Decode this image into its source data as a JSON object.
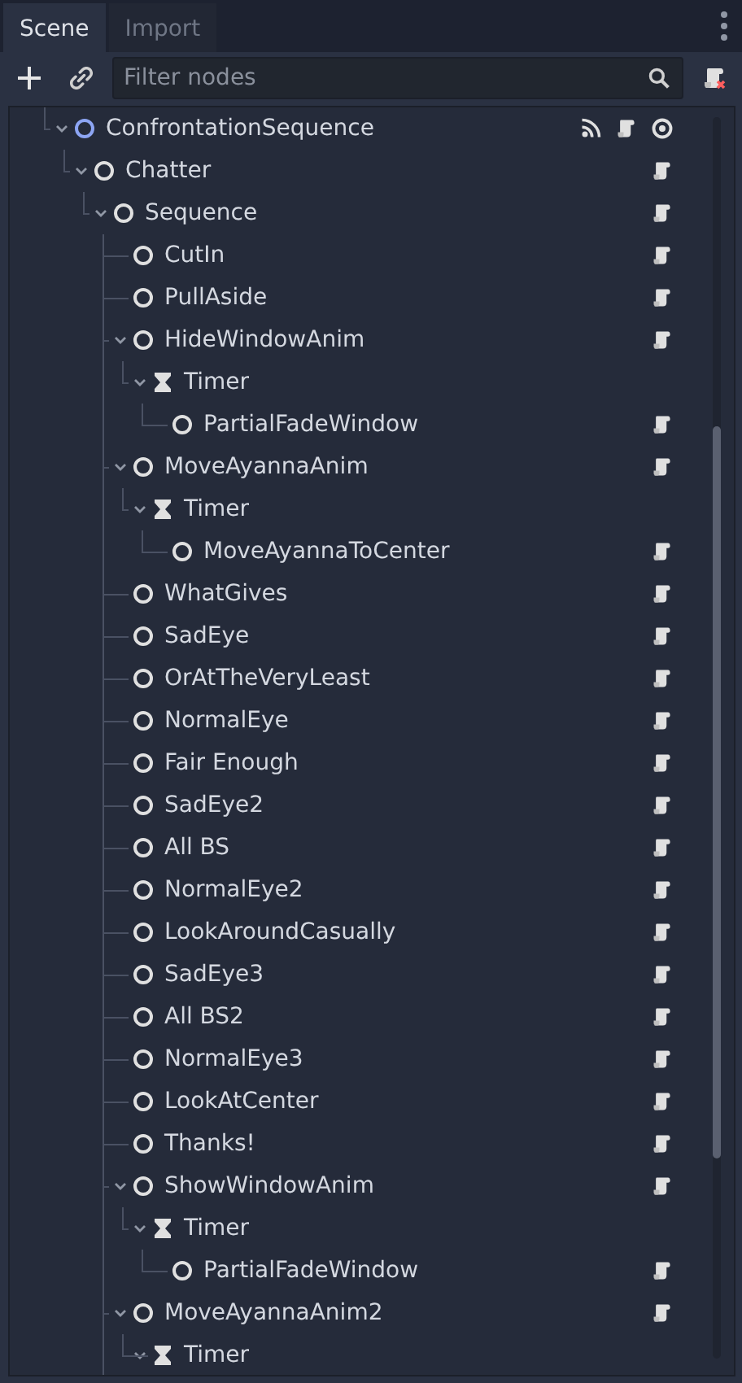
{
  "tabs": [
    {
      "label": "Scene",
      "selected": true
    },
    {
      "label": "Import",
      "selected": false
    }
  ],
  "toolbar": {
    "filter": {
      "placeholder": "Filter nodes"
    }
  },
  "tree": [
    {
      "name": "ConfrontationSequence",
      "kind": "node",
      "color": "#8da5f3",
      "expanded": true,
      "badges": [
        {
          "kind": "signal"
        },
        {
          "kind": "script"
        },
        {
          "kind": "visibility"
        }
      ],
      "children": [
        {
          "name": "Chatter",
          "kind": "node",
          "color": "#e0e0e0",
          "expanded": true,
          "badges": [
            {
              "kind": "script"
            }
          ],
          "children": [
            {
              "name": "Sequence",
              "kind": "node",
              "color": "#e0e0e0",
              "expanded": true,
              "continues_below": true,
              "badges": [
                {
                  "kind": "script"
                }
              ],
              "children": [
                {
                  "name": "CutIn",
                  "kind": "node",
                  "color": "#e0e0e0",
                  "badges": [
                    {
                      "kind": "script"
                    }
                  ]
                },
                {
                  "name": "PullAside",
                  "kind": "node",
                  "color": "#e0e0e0",
                  "badges": [
                    {
                      "kind": "script"
                    }
                  ]
                },
                {
                  "name": "HideWindowAnim",
                  "kind": "node",
                  "color": "#e0e0e0",
                  "expanded": true,
                  "badges": [
                    {
                      "kind": "script"
                    }
                  ],
                  "children": [
                    {
                      "name": "Timer",
                      "kind": "timer",
                      "color": "#e0e0e0",
                      "expanded": true,
                      "children": [
                        {
                          "name": "PartialFadeWindow",
                          "kind": "node",
                          "color": "#e0e0e0",
                          "badges": [
                            {
                              "kind": "script"
                            }
                          ]
                        }
                      ]
                    }
                  ]
                },
                {
                  "name": "MoveAyannaAnim",
                  "kind": "node",
                  "color": "#e0e0e0",
                  "expanded": true,
                  "badges": [
                    {
                      "kind": "script"
                    }
                  ],
                  "children": [
                    {
                      "name": "Timer",
                      "kind": "timer",
                      "color": "#e0e0e0",
                      "expanded": true,
                      "children": [
                        {
                          "name": "MoveAyannaToCenter",
                          "kind": "node",
                          "color": "#e0e0e0",
                          "badges": [
                            {
                              "kind": "script"
                            }
                          ]
                        }
                      ]
                    }
                  ]
                },
                {
                  "name": "WhatGives",
                  "kind": "node",
                  "color": "#e0e0e0",
                  "badges": [
                    {
                      "kind": "script"
                    }
                  ]
                },
                {
                  "name": "SadEye",
                  "kind": "node",
                  "color": "#e0e0e0",
                  "badges": [
                    {
                      "kind": "script"
                    }
                  ]
                },
                {
                  "name": "OrAtTheVeryLeast",
                  "kind": "node",
                  "color": "#e0e0e0",
                  "badges": [
                    {
                      "kind": "script"
                    }
                  ]
                },
                {
                  "name": "NormalEye",
                  "kind": "node",
                  "color": "#e0e0e0",
                  "badges": [
                    {
                      "kind": "script"
                    }
                  ]
                },
                {
                  "name": "Fair Enough",
                  "kind": "node",
                  "color": "#e0e0e0",
                  "badges": [
                    {
                      "kind": "script"
                    }
                  ]
                },
                {
                  "name": "SadEye2",
                  "kind": "node",
                  "color": "#e0e0e0",
                  "badges": [
                    {
                      "kind": "script"
                    }
                  ]
                },
                {
                  "name": "All BS",
                  "kind": "node",
                  "color": "#e0e0e0",
                  "badges": [
                    {
                      "kind": "script"
                    }
                  ]
                },
                {
                  "name": "NormalEye2",
                  "kind": "node",
                  "color": "#e0e0e0",
                  "badges": [
                    {
                      "kind": "script"
                    }
                  ]
                },
                {
                  "name": "LookAroundCasually",
                  "kind": "node",
                  "color": "#e0e0e0",
                  "badges": [
                    {
                      "kind": "script"
                    }
                  ]
                },
                {
                  "name": "SadEye3",
                  "kind": "node",
                  "color": "#e0e0e0",
                  "badges": [
                    {
                      "kind": "script"
                    }
                  ]
                },
                {
                  "name": "All BS2",
                  "kind": "node",
                  "color": "#e0e0e0",
                  "badges": [
                    {
                      "kind": "script"
                    }
                  ]
                },
                {
                  "name": "NormalEye3",
                  "kind": "node",
                  "color": "#e0e0e0",
                  "badges": [
                    {
                      "kind": "script"
                    }
                  ]
                },
                {
                  "name": "LookAtCenter",
                  "kind": "node",
                  "color": "#e0e0e0",
                  "badges": [
                    {
                      "kind": "script"
                    }
                  ]
                },
                {
                  "name": "Thanks!",
                  "kind": "node",
                  "color": "#e0e0e0",
                  "badges": [
                    {
                      "kind": "script"
                    }
                  ]
                },
                {
                  "name": "ShowWindowAnim",
                  "kind": "node",
                  "color": "#e0e0e0",
                  "expanded": true,
                  "badges": [
                    {
                      "kind": "script"
                    }
                  ],
                  "children": [
                    {
                      "name": "Timer",
                      "kind": "timer",
                      "color": "#e0e0e0",
                      "expanded": true,
                      "children": [
                        {
                          "name": "PartialFadeWindow",
                          "kind": "node",
                          "color": "#e0e0e0",
                          "badges": [
                            {
                              "kind": "script"
                            }
                          ]
                        }
                      ]
                    }
                  ]
                },
                {
                  "name": "MoveAyannaAnim2",
                  "kind": "node",
                  "color": "#e0e0e0",
                  "expanded": true,
                  "badges": [
                    {
                      "kind": "script"
                    }
                  ],
                  "children": [
                    {
                      "name": "Timer",
                      "kind": "timer",
                      "color": "#e0e0e0",
                      "expanded": true
                    }
                  ]
                }
              ]
            }
          ]
        }
      ]
    }
  ]
}
